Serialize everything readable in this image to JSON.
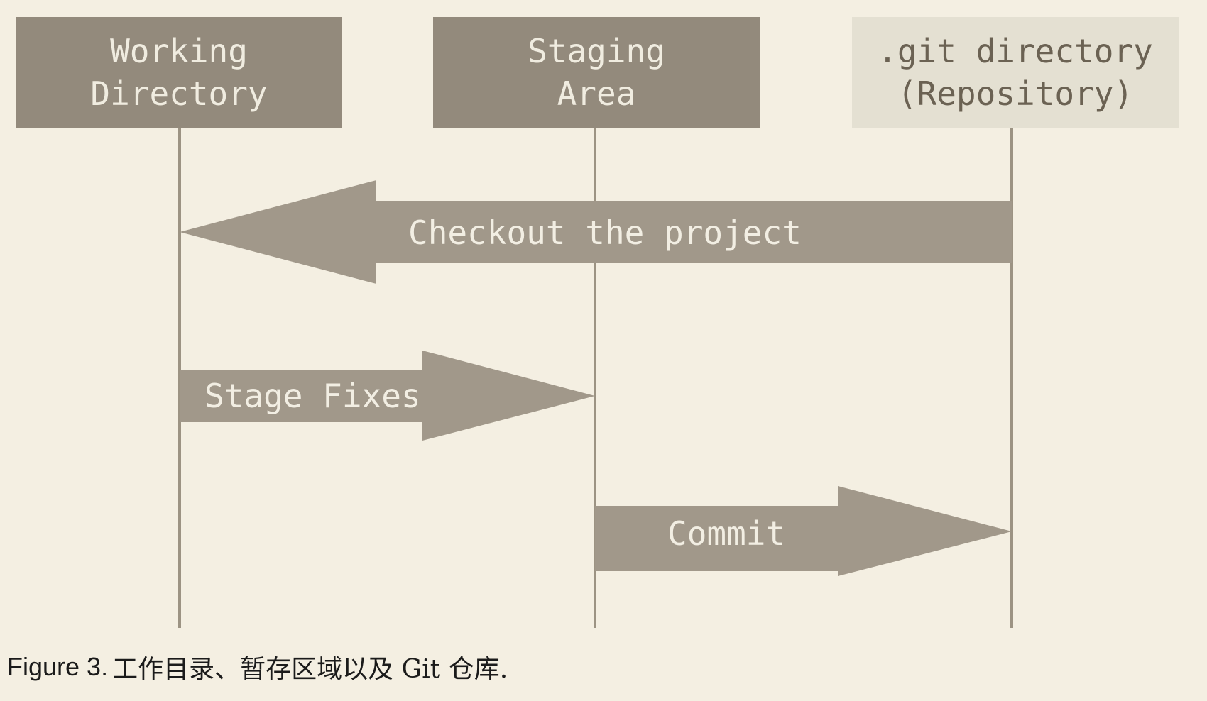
{
  "figure": {
    "caption_prefix": "Figure 3.",
    "caption_text": "工作目录、暂存区域以及 Git 仓库.",
    "background_color": "#f4efe2"
  },
  "colors": {
    "node_fill_dark": "#938a7c",
    "node_fill_light": "#e4e0d2",
    "node_text_light": "#f0ece0",
    "node_text_dark": "#6b6253",
    "arrow_fill": "#a1988a",
    "arrow_text": "#f2eee3",
    "lifeline": "#9c9383"
  },
  "nodes": [
    {
      "id": "working-directory",
      "line1": "Working",
      "line2": "Directory",
      "style": "dark"
    },
    {
      "id": "staging-area",
      "line1": "Staging",
      "line2": "Area",
      "style": "dark"
    },
    {
      "id": "git-directory",
      "line1": ".git directory",
      "line2": "(Repository)",
      "style": "light"
    }
  ],
  "arrows": [
    {
      "id": "checkout",
      "label": "Checkout the project",
      "direction": "left",
      "from": "git-directory",
      "to": "working-directory"
    },
    {
      "id": "stage-fixes",
      "label": "Stage Fixes",
      "direction": "right",
      "from": "working-directory",
      "to": "staging-area"
    },
    {
      "id": "commit",
      "label": "Commit",
      "direction": "right",
      "from": "staging-area",
      "to": "git-directory"
    }
  ]
}
